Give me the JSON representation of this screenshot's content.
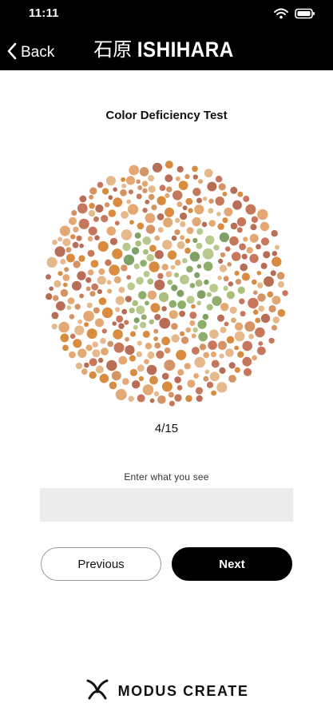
{
  "status_bar": {
    "time": "11:11",
    "icons": [
      "wifi-icon",
      "battery-icon"
    ]
  },
  "nav": {
    "back_label": "Back",
    "brand_kanji": "石原",
    "brand_latin": "ISHIHARA"
  },
  "test": {
    "title": "Color Deficiency Test",
    "progress": "4/15",
    "plate_number_shown": "14",
    "plate_colors": {
      "background": [
        "#d98c3f",
        "#e3a873",
        "#c7775b",
        "#e6b98c",
        "#d49466",
        "#b86d57"
      ],
      "figure": [
        "#8fae6b",
        "#a9c07d",
        "#7ea164",
        "#b7c98c"
      ]
    }
  },
  "answer": {
    "label": "Enter what you see",
    "value": "",
    "placeholder": ""
  },
  "buttons": {
    "previous": "Previous",
    "next": "Next"
  },
  "footer": {
    "brand": "MODUS CREATE"
  }
}
